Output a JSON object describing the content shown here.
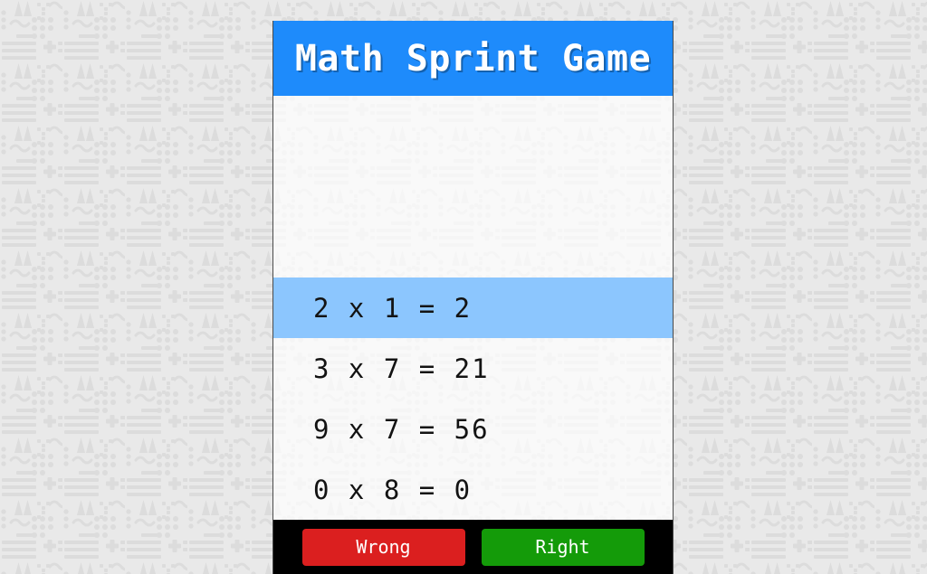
{
  "header": {
    "title": "Math Sprint Game",
    "background_color": "#1e8bfb",
    "text_color": "#ffffff"
  },
  "board": {
    "current_index": 0,
    "highlight_color": "#8cc6fe",
    "equations": [
      {
        "left": "2",
        "operator": "x",
        "right": "1",
        "equals": "=",
        "result": "2",
        "display": "2 x 1 = 2",
        "current": true
      },
      {
        "left": "3",
        "operator": "x",
        "right": "7",
        "equals": "=",
        "result": "21",
        "display": "3 x 7 = 21",
        "current": false
      },
      {
        "left": "9",
        "operator": "x",
        "right": "7",
        "equals": "=",
        "result": "56",
        "display": "9 x 7 = 56",
        "current": false
      },
      {
        "left": "0",
        "operator": "x",
        "right": "8",
        "equals": "=",
        "result": "0",
        "display": "0 x 8 = 0",
        "current": false
      }
    ]
  },
  "footer": {
    "background_color": "#000000",
    "wrong_label": "Wrong",
    "wrong_color": "#db1f1f",
    "right_label": "Right",
    "right_color": "#149b09"
  },
  "background": {
    "base_color": "#e9e9e9",
    "motif_color": "#dcdcdc",
    "tile_size": 69
  }
}
